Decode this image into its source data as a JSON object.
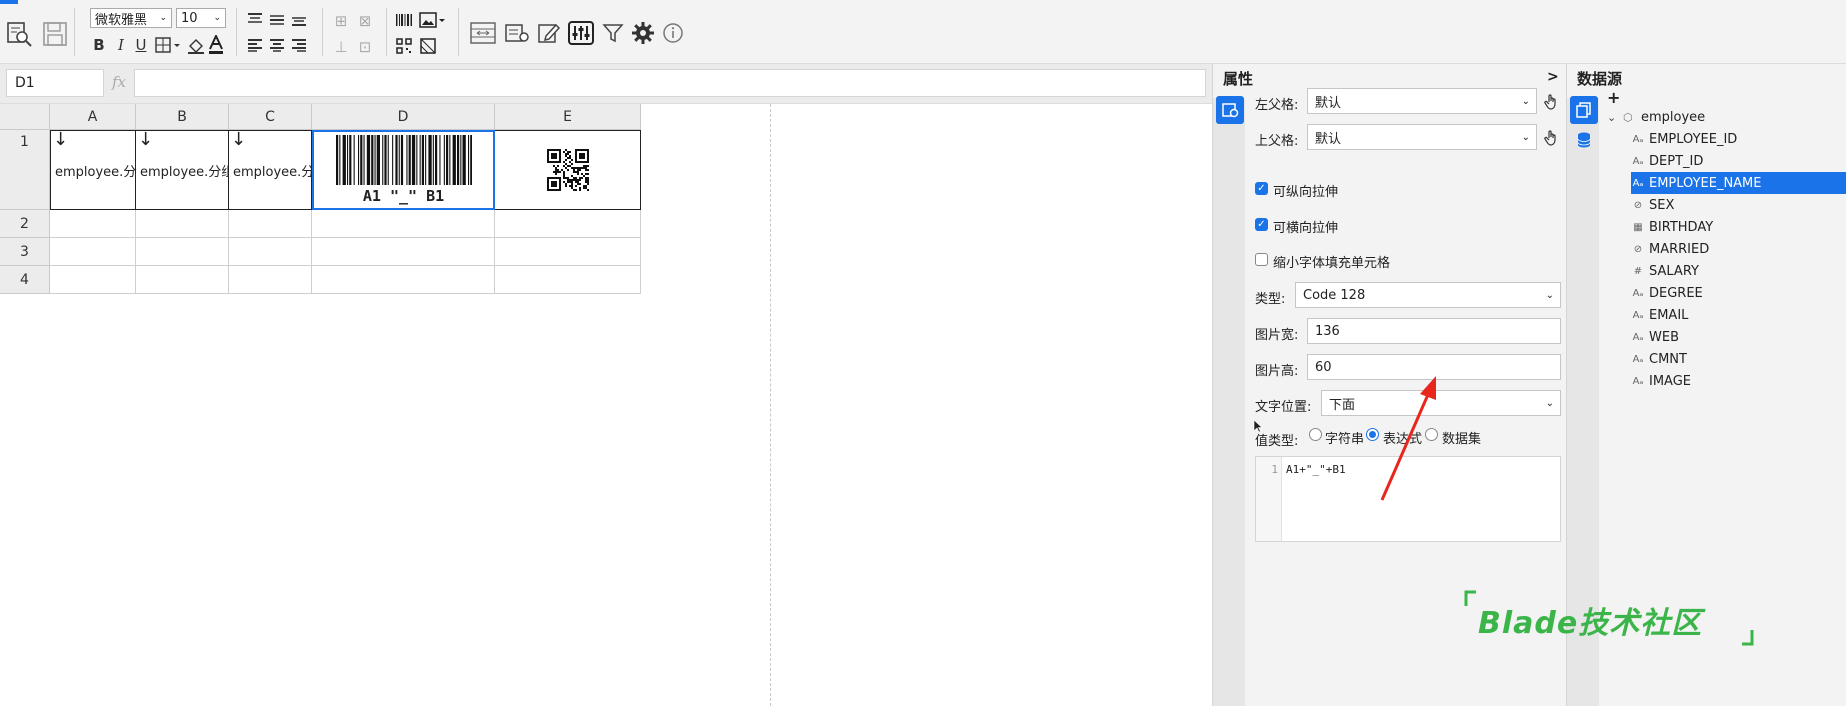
{
  "toolbar": {
    "font_name": "微软雅黑",
    "font_size": "10",
    "bold": "B",
    "italic": "I",
    "underline": "U"
  },
  "formula": {
    "cell_ref": "D1",
    "fx": "fx",
    "value": ""
  },
  "grid": {
    "col_headers": [
      "A",
      "B",
      "C",
      "D",
      "E"
    ],
    "row_headers": [
      "1",
      "2",
      "3",
      "4"
    ],
    "cells": {
      "a1_arrow": "↓",
      "a1": "employee.分组",
      "b1_arrow": "↓",
      "b1": "employee.分组",
      "c1_arrow": "↓",
      "c1": "employee.分组",
      "d1_text": "A1 \"_\" B1"
    }
  },
  "props": {
    "title": "属性",
    "collapse": ">",
    "left_parent_label": "左父格:",
    "left_parent_value": "默认",
    "top_parent_label": "上父格:",
    "top_parent_value": "默认",
    "vstretch_label": "可纵向拉伸",
    "vstretch_checked": true,
    "hstretch_label": "可横向拉伸",
    "hstretch_checked": true,
    "shrink_label": "缩小字体填充单元格",
    "shrink_checked": false,
    "type_label": "类型:",
    "type_value": "Code 128",
    "width_label": "图片宽:",
    "width_value": "136",
    "height_label": "图片高:",
    "height_value": "60",
    "textpos_label": "文字位置:",
    "textpos_value": "下面",
    "valuetype_label": "值类型:",
    "valuetype_options": [
      "字符串",
      "表达式",
      "数据集"
    ],
    "valuetype_selected": "表达式",
    "editor_line": "1",
    "editor_code": "A1+\"_\"+B1"
  },
  "datasource": {
    "title": "数据源",
    "add": "+",
    "root": "employee",
    "fields": [
      {
        "name": "EMPLOYEE_ID",
        "icon": "text-field-icon"
      },
      {
        "name": "DEPT_ID",
        "icon": "text-field-icon"
      },
      {
        "name": "EMPLOYEE_NAME",
        "icon": "text-field-icon"
      },
      {
        "name": "SEX",
        "icon": "boolean-field-icon"
      },
      {
        "name": "BIRTHDAY",
        "icon": "date-field-icon"
      },
      {
        "name": "MARRIED",
        "icon": "boolean-field-icon"
      },
      {
        "name": "SALARY",
        "icon": "number-field-icon"
      },
      {
        "name": "DEGREE",
        "icon": "text-field-icon"
      },
      {
        "name": "EMAIL",
        "icon": "text-field-icon"
      },
      {
        "name": "WEB",
        "icon": "text-field-icon"
      },
      {
        "name": "CMNT",
        "icon": "text-field-icon"
      },
      {
        "name": "IMAGE",
        "icon": "text-field-icon"
      }
    ],
    "selected": "EMPLOYEE_NAME"
  },
  "watermark": "Blade技术社区",
  "colors": {
    "accent": "#1a73e8",
    "arrow": "#e8261c",
    "watermark": "#3bb54a"
  }
}
